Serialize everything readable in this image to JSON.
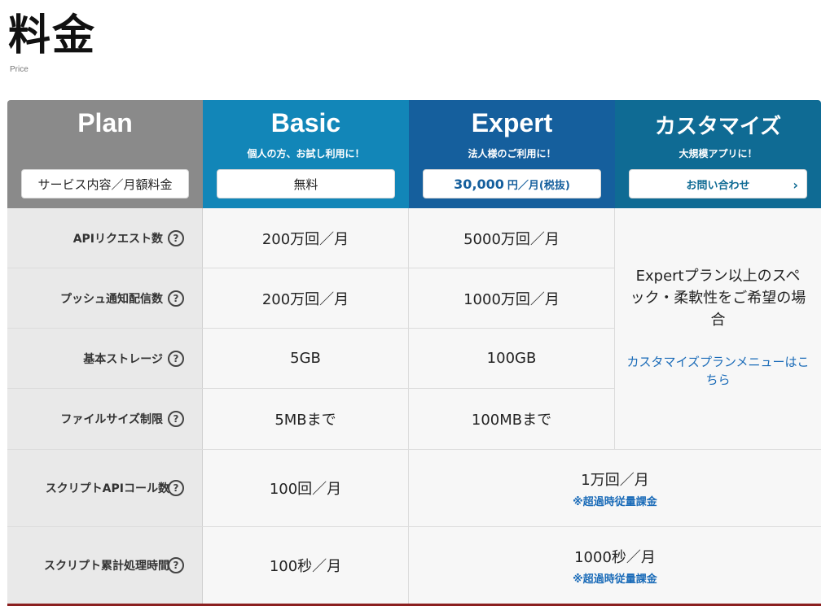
{
  "page": {
    "title": "料金",
    "subtitle": "Price"
  },
  "plans": {
    "plan": {
      "title": "Plan",
      "button": "サービス内容／月額料金"
    },
    "basic": {
      "title": "Basic",
      "subtitle": "個人の方、お試し利用に！",
      "button": "無料"
    },
    "expert": {
      "title": "Expert",
      "subtitle": "法人様のご利用に！",
      "price": "30,000",
      "price_unit": "円／月(税抜)"
    },
    "custom": {
      "title": "カスタマイズ",
      "subtitle": "大規模アプリに！",
      "button": "お問い合わせ"
    }
  },
  "rows": [
    {
      "label": "APIリクエスト数",
      "basic": "200万回／月",
      "expert": "5000万回／月"
    },
    {
      "label": "プッシュ通知配信数",
      "basic": "200万回／月",
      "expert": "1000万回／月"
    },
    {
      "label": "基本ストレージ",
      "basic": "5GB",
      "expert": "100GB"
    },
    {
      "label": "ファイルサイズ制限",
      "basic": "5MBまで",
      "expert": "100MBまで"
    },
    {
      "label": "スクリプトAPIコール数",
      "basic": "100回／月",
      "expert": "1万回／月",
      "note": "※超過時従量課金"
    },
    {
      "label": "スクリプト累計処理時間",
      "basic": "100秒／月",
      "expert": "1000秒／月",
      "note": "※超過時従量課金"
    }
  ],
  "custom_cell": {
    "text": "Expertプラン以上のスペック・柔軟性をご希望の場合",
    "link": "カスタマイズプランメニューはこちら"
  },
  "help_symbol": "?",
  "chevron": "›",
  "colors": {
    "plan_header": "#8a8a8a",
    "basic_header": "#1286b8",
    "expert_header": "#155f9d",
    "custom_header": "#0f6b94",
    "link": "#1a6bb8",
    "bottom_rule": "#8b1f1f"
  }
}
